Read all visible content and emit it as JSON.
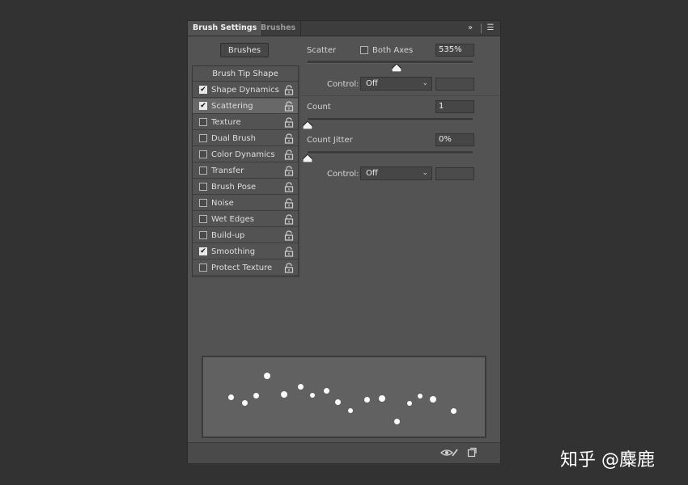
{
  "tabs": {
    "active": "Brush Settings",
    "inactive": "Brushes"
  },
  "toolbar_icons": {
    "expand": "double-chevron-right-icon",
    "menu": "hamburger-menu-icon"
  },
  "brushes_button": "Brushes",
  "brush_tip_shape": "Brush Tip Shape",
  "options": [
    {
      "label": "Shape Dynamics",
      "checked": true
    },
    {
      "label": "Scattering",
      "checked": true,
      "selected": true
    },
    {
      "label": "Texture",
      "checked": false
    },
    {
      "label": "Dual Brush",
      "checked": false
    },
    {
      "label": "Color Dynamics",
      "checked": false
    },
    {
      "label": "Transfer",
      "checked": false
    },
    {
      "label": "Brush Pose",
      "checked": false
    },
    {
      "label": "Noise",
      "checked": false
    },
    {
      "label": "Wet Edges",
      "checked": false
    },
    {
      "label": "Build-up",
      "checked": false
    },
    {
      "label": "Smoothing",
      "checked": true
    },
    {
      "label": "Protect Texture",
      "checked": false
    }
  ],
  "scatter": {
    "label": "Scatter",
    "both_axes_label": "Both Axes",
    "both_axes_checked": false,
    "value": "535%",
    "slider_fraction": 0.54,
    "control_label": "Control:",
    "control_value": "Off"
  },
  "count": {
    "label": "Count",
    "value": "1",
    "slider_fraction": 0.0
  },
  "count_jitter": {
    "label": "Count Jitter",
    "value": "0%",
    "slider_fraction": 0.0,
    "control_label": "Control:",
    "control_value": "Off"
  },
  "bottom_icons": {
    "left": "eye-brush-icon",
    "right": "new-preset-icon"
  },
  "watermark": "知乎 @麋鹿"
}
